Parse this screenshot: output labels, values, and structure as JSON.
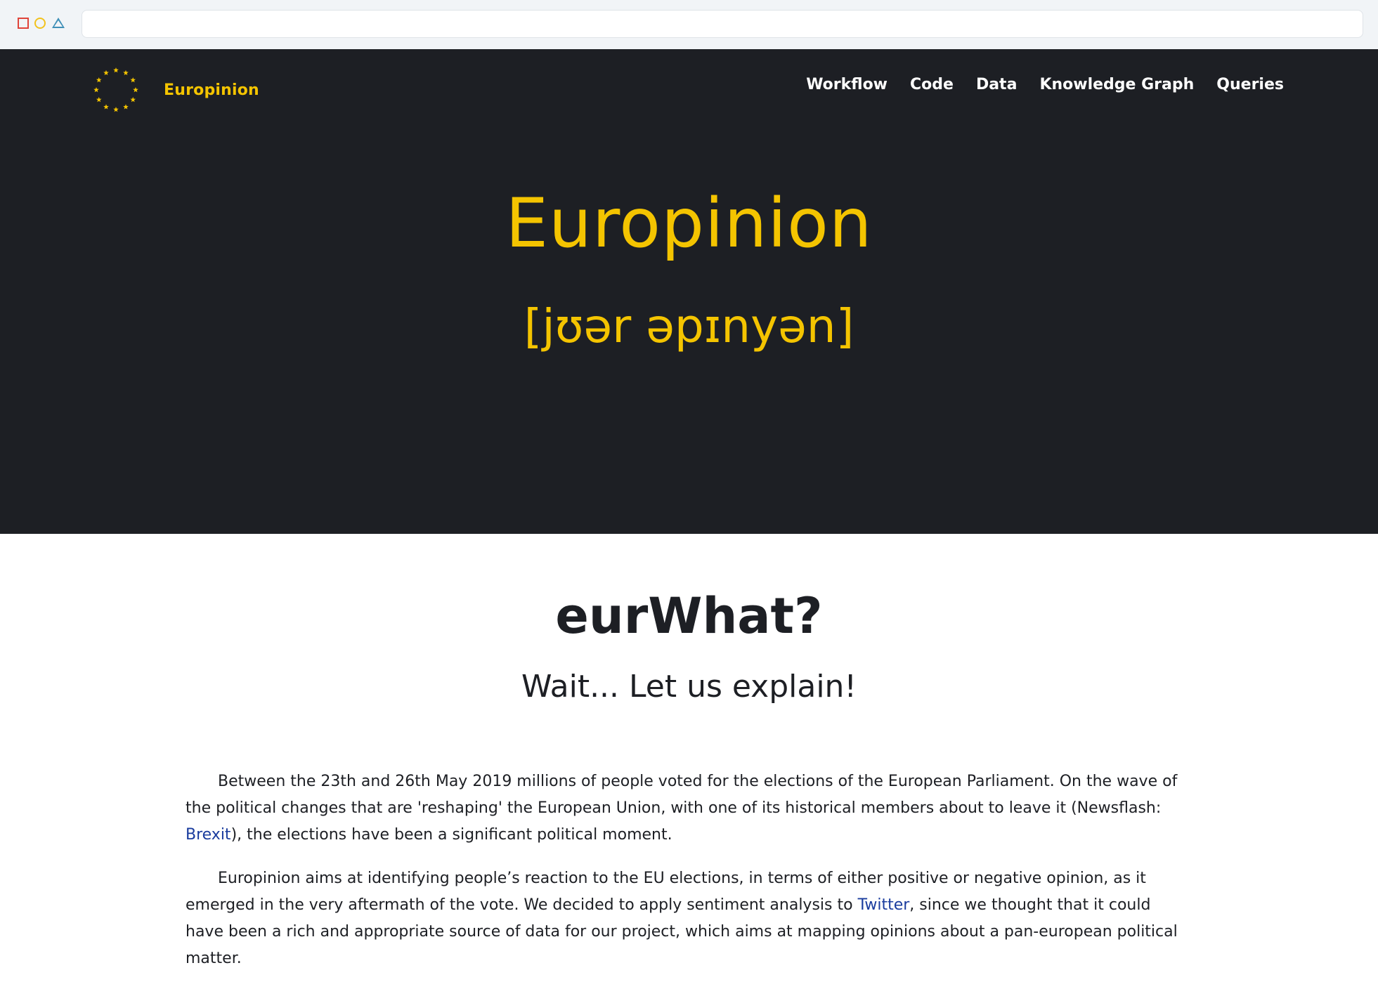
{
  "brand": {
    "name": "Europinion"
  },
  "nav": [
    "Workflow",
    "Code",
    "Data",
    "Knowledge Graph",
    "Queries"
  ],
  "hero": {
    "title": "Europinion",
    "phonetic": "[jʊər əpɪnyən]"
  },
  "section": {
    "title": "eurWhat?",
    "subtitle": "Wait... Let us explain!"
  },
  "paragraphs": {
    "p1_before": "Between the 23th and 26th May 2019 millions of people voted for the elections of the European Parliament. On the wave of the political changes that are 'reshaping' the European Union, with one of its historical members about to leave it (Newsflash: ",
    "p1_link": "Brexit",
    "p1_after": "), the elections have been a significant political moment.",
    "p2_before": "Europinion aims at identifying people’s reaction to the EU elections, in terms of either positive or negative opinion, as it emerged in the very aftermath of the vote. We decided to apply sentiment analysis to ",
    "p2_link": "Twitter",
    "p2_after": ", since we thought that it could have been a rich and appropriate source of data for our project, which aims at mapping opinions about a pan-european political matter."
  },
  "colors": {
    "accent": "#f4c400",
    "hero_bg": "#1d1f24",
    "link": "#1a3c9e",
    "text": "#1d1f24"
  },
  "icons": {
    "logo": "eu-stars-circle-icon",
    "window_close": "close-square-icon",
    "window_minimize": "minimize-circle-icon",
    "window_maximize": "maximize-triangle-icon"
  }
}
